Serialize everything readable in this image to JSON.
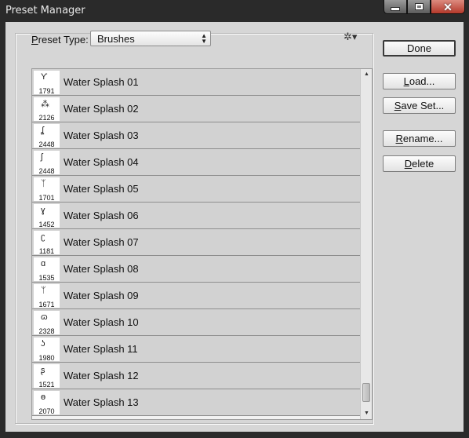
{
  "window": {
    "title": "Preset Manager"
  },
  "preset_type": {
    "label": "Preset Type:",
    "value": "Brushes"
  },
  "buttons": {
    "done": "Done",
    "load": "Load...",
    "save_set": "Save Set...",
    "rename": "Rename...",
    "delete": "Delete"
  },
  "presets": [
    {
      "size": "1791",
      "name": "Water Splash 01"
    },
    {
      "size": "2126",
      "name": "Water Splash 02"
    },
    {
      "size": "2448",
      "name": "Water Splash 03"
    },
    {
      "size": "2448",
      "name": "Water Splash 04"
    },
    {
      "size": "1701",
      "name": "Water Splash 05"
    },
    {
      "size": "1452",
      "name": "Water Splash 06"
    },
    {
      "size": "1181",
      "name": "Water Splash 07"
    },
    {
      "size": "1535",
      "name": "Water Splash 08"
    },
    {
      "size": "1671",
      "name": "Water Splash 09"
    },
    {
      "size": "2328",
      "name": "Water Splash 10"
    },
    {
      "size": "1980",
      "name": "Water Splash 11"
    },
    {
      "size": "1521",
      "name": "Water Splash 12"
    },
    {
      "size": "2070",
      "name": "Water Splash 13"
    }
  ]
}
